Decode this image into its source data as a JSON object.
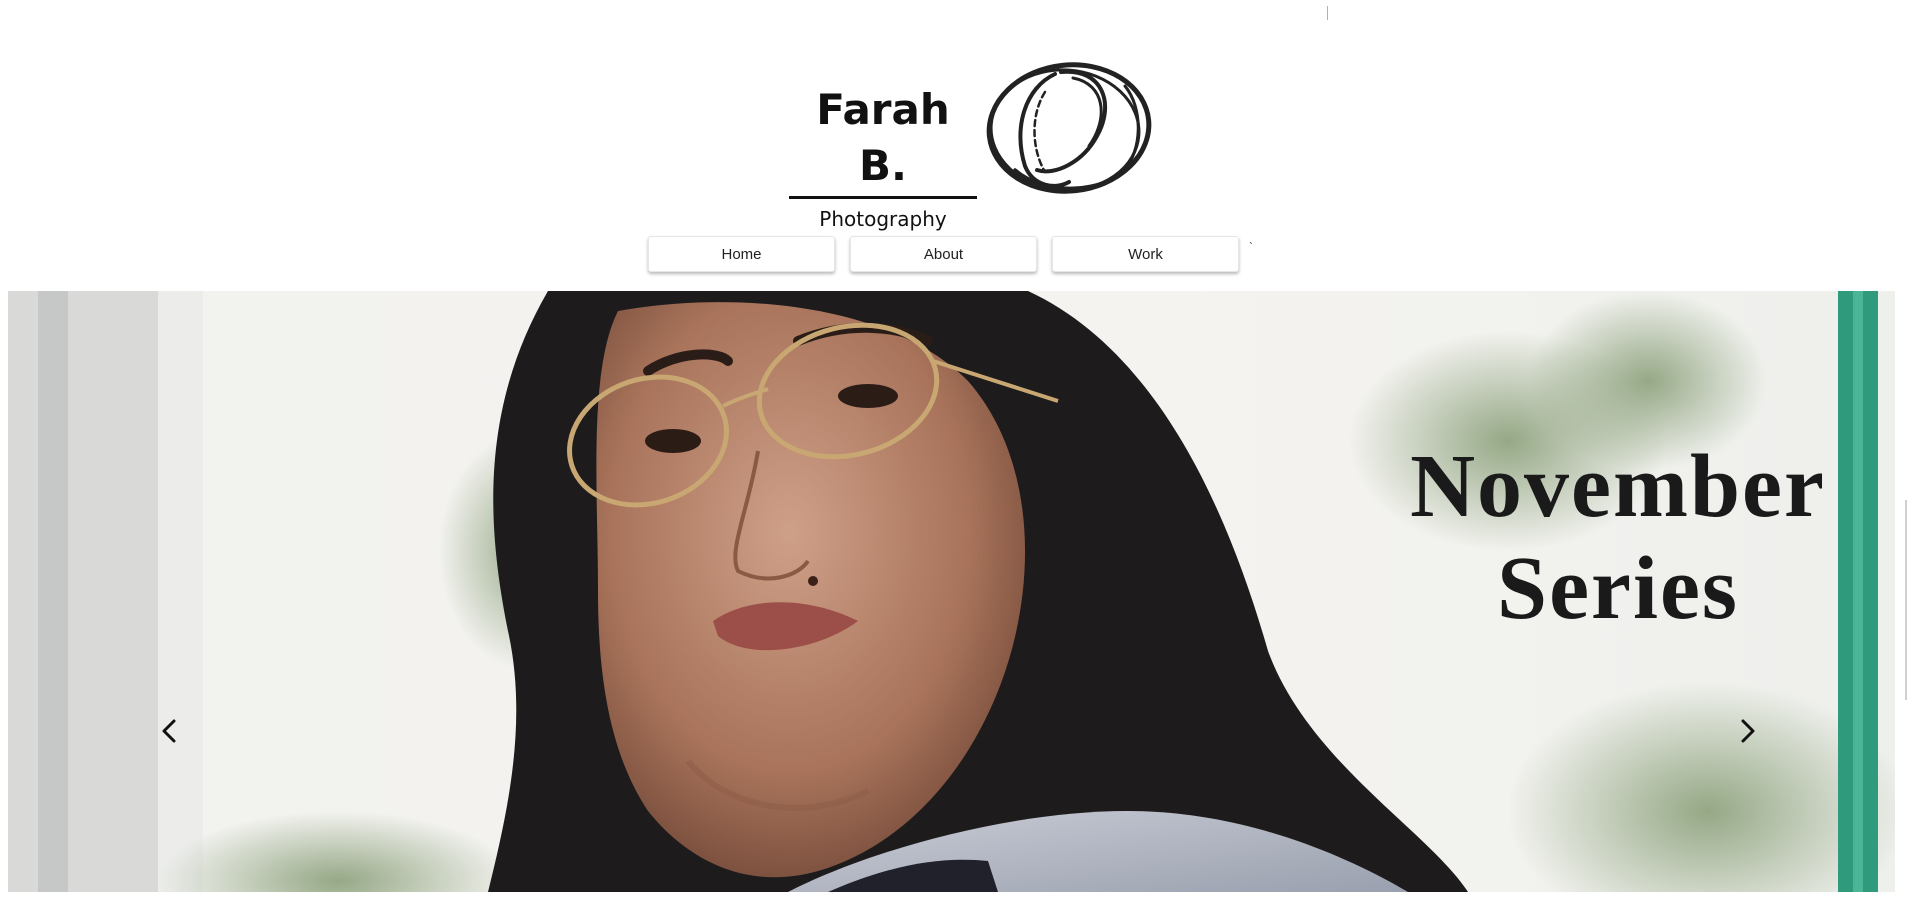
{
  "brand": {
    "name": "Farah B.",
    "subtitle": "Photography",
    "logo_icon": "scribble-circle-icon"
  },
  "nav": {
    "items": [
      {
        "label": "Home"
      },
      {
        "label": "About"
      },
      {
        "label": "Work"
      }
    ],
    "trailing_mark": "`"
  },
  "hero": {
    "title_line1": "November",
    "title_line2": "Series",
    "prev_icon": "chevron-left-icon",
    "next_icon": "chevron-right-icon",
    "image": "portrait-photo"
  }
}
